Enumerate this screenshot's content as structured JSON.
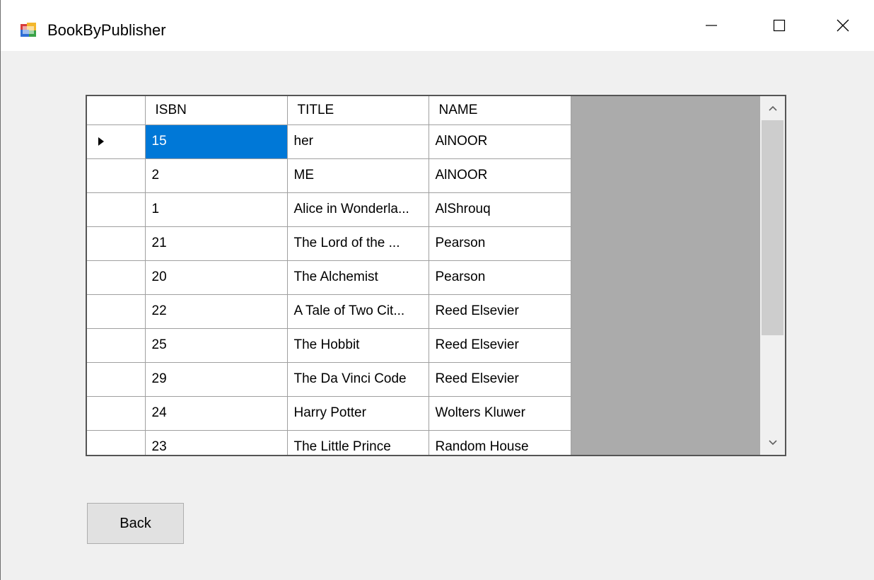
{
  "window": {
    "title": "BookByPublisher",
    "minimize_label": "—",
    "maximize_label": "☐",
    "close_label": "✕"
  },
  "grid": {
    "columns": [
      "ISBN",
      "TITLE",
      "NAME"
    ],
    "selected_row": 0,
    "rows": [
      {
        "isbn": "15",
        "title": "her",
        "name": "AlNOOR"
      },
      {
        "isbn": "2",
        "title": "ME",
        "name": "AlNOOR"
      },
      {
        "isbn": "1",
        "title": "Alice in Wonderla...",
        "name": "AlShrouq"
      },
      {
        "isbn": "21",
        "title": "The Lord of the ...",
        "name": "Pearson"
      },
      {
        "isbn": "20",
        "title": "The Alchemist",
        "name": "Pearson"
      },
      {
        "isbn": "22",
        "title": "A Tale of Two Cit...",
        "name": "Reed Elsevier"
      },
      {
        "isbn": "25",
        "title": "The Hobbit",
        "name": "Reed Elsevier"
      },
      {
        "isbn": "29",
        "title": "The Da Vinci Code",
        "name": "Reed Elsevier"
      },
      {
        "isbn": "24",
        "title": "Harry Potter",
        "name": "Wolters Kluwer"
      },
      {
        "isbn": "23",
        "title": "The Little Prince",
        "name": "Random House"
      }
    ]
  },
  "actions": {
    "back_label": "Back"
  },
  "colors": {
    "selection": "#0078d7",
    "grid_background": "#ababab",
    "window_background": "#f0f0f0"
  }
}
